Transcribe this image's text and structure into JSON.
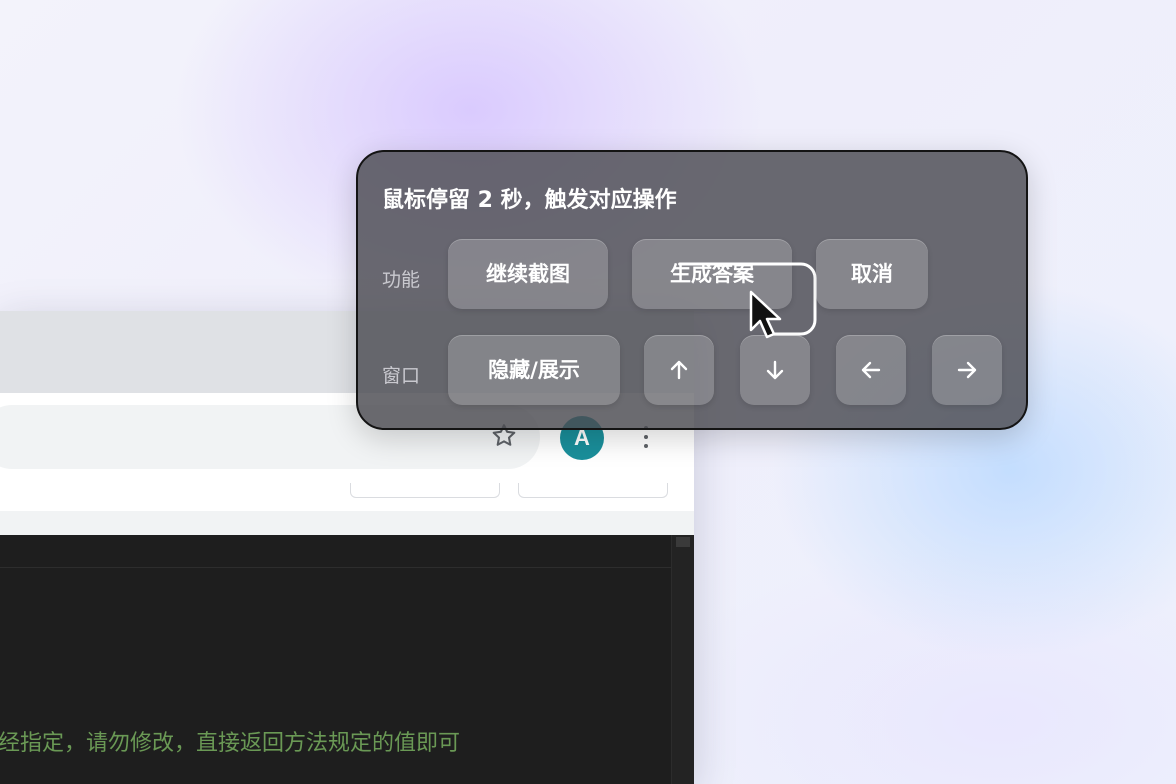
{
  "overlay": {
    "title": "鼠标停留 2 秒，触发对应操作",
    "rows": [
      {
        "label": "功能",
        "buttons": [
          {
            "label": "继续截图"
          },
          {
            "label": "生成答案",
            "hover_progress": 0.55
          },
          {
            "label": "取消"
          }
        ]
      },
      {
        "label": "窗口",
        "buttons": [
          {
            "label": "隐藏/展示"
          },
          {
            "icon": "arrow-up-icon",
            "glyph": "↑"
          },
          {
            "icon": "arrow-down-icon",
            "glyph": "↓"
          },
          {
            "icon": "arrow-left-icon",
            "glyph": "←"
          },
          {
            "icon": "arrow-right-icon",
            "glyph": "→"
          }
        ]
      }
    ]
  },
  "browser": {
    "avatar_letter": "A",
    "avatar_color": "#1a8f9b",
    "toolbar_icons": [
      "star-icon",
      "kebab-menu-icon"
    ]
  },
  "editor": {
    "comment_line": "经指定，请勿修改，直接返回方法规定的值即可",
    "comment_color": "#6a9955",
    "background": "#1e1e1e"
  },
  "cursor": {
    "icon": "mouse-pointer-icon"
  }
}
